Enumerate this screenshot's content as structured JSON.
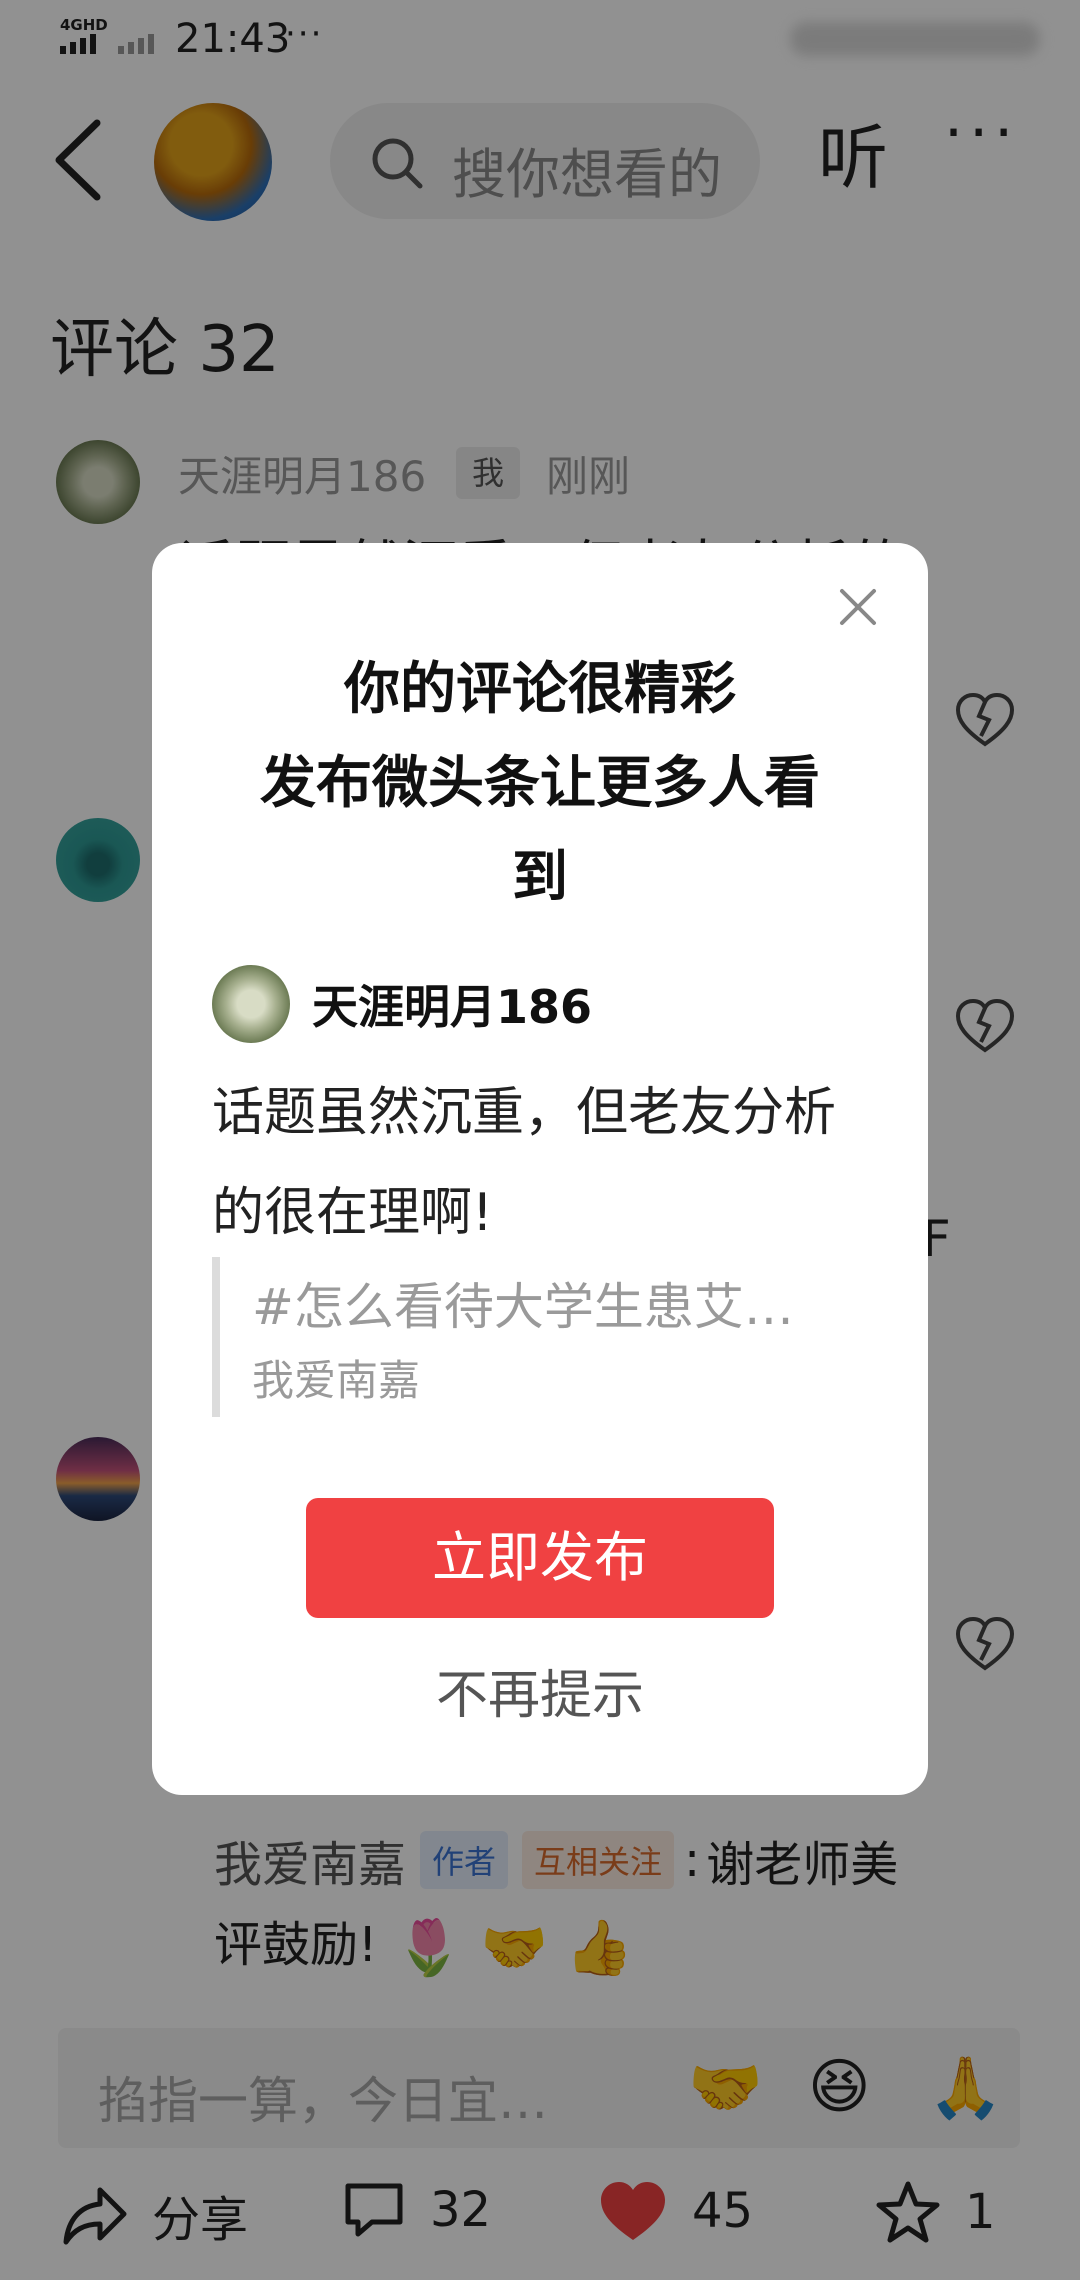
{
  "status_bar": {
    "network": "4GHD",
    "time": "21:43",
    "dots": "···"
  },
  "top_bar": {
    "search_placeholder": "搜你想看的",
    "listen_label": "听",
    "more_label": "···"
  },
  "comments": {
    "title": "评论 32",
    "first": {
      "user": "天涯明月186",
      "me_badge": "我",
      "time": "刚刚",
      "text_partial": "话题虽然沉重，但老友分析的"
    },
    "stray_char": "F",
    "reply": {
      "author": "我爱南嘉",
      "author_tag": "作者",
      "mutual_tag": "互相关注",
      "colon": ":",
      "text_line1": "谢老师美",
      "text_line2": "评鼓励!",
      "emojis": [
        "🌷",
        "🤝",
        "👍"
      ]
    }
  },
  "comment_input": {
    "placeholder": "掐指一算，今日宜…",
    "emojis": [
      "🤝",
      "😆",
      "🙏"
    ]
  },
  "bottom_bar": {
    "share_label": "分享",
    "comment_count": "32",
    "like_count": "45",
    "favorite_count": "1"
  },
  "modal": {
    "title": "你的评论很精彩\n发布微头条让更多人看\n到",
    "author_name": "天涯明月186",
    "comment_text": "话题虽然沉重，但老友分析的很在理啊!",
    "quote_topic": "#怎么看待大学生患艾…",
    "quote_author": "我爱南嘉",
    "publish_button": "立即发布",
    "dont_remind": "不再提示"
  },
  "colors": {
    "accent_red": "#f04142",
    "overlay": "rgba(0,0,0,0.43)"
  }
}
